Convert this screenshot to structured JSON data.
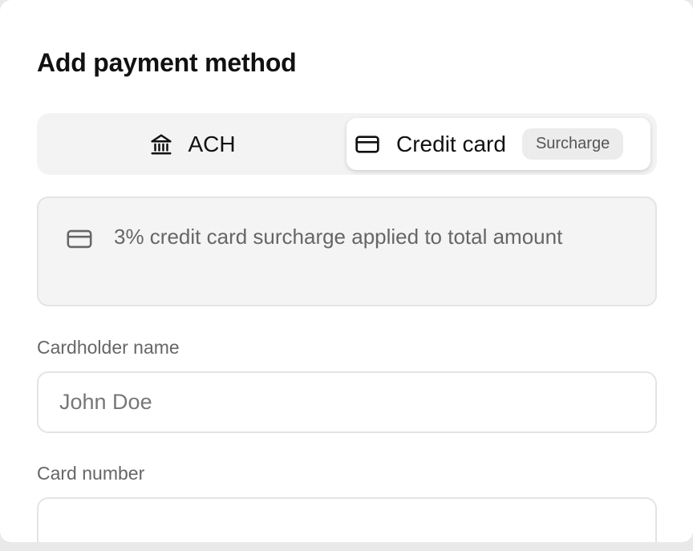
{
  "dialog": {
    "title": "Add payment method"
  },
  "method_selector": {
    "selected": "Credit card",
    "options": [
      {
        "label": "ACH",
        "icon": "bank-icon"
      },
      {
        "label": "Credit card",
        "icon": "credit-card-icon",
        "badge": "Surcharge"
      }
    ]
  },
  "notice": {
    "icon": "credit-card-icon",
    "text": "3% credit card surcharge applied to total amount"
  },
  "fields": {
    "cardholder_name": {
      "label": "Cardholder name",
      "value": "",
      "placeholder": "John Doe"
    },
    "card_number": {
      "label": "Card number",
      "value": "",
      "placeholder": ""
    }
  },
  "colors": {
    "text_primary": "#111111",
    "text_secondary": "#666666",
    "segment_bg": "#f3f3f3",
    "border": "#e4e4e4"
  }
}
